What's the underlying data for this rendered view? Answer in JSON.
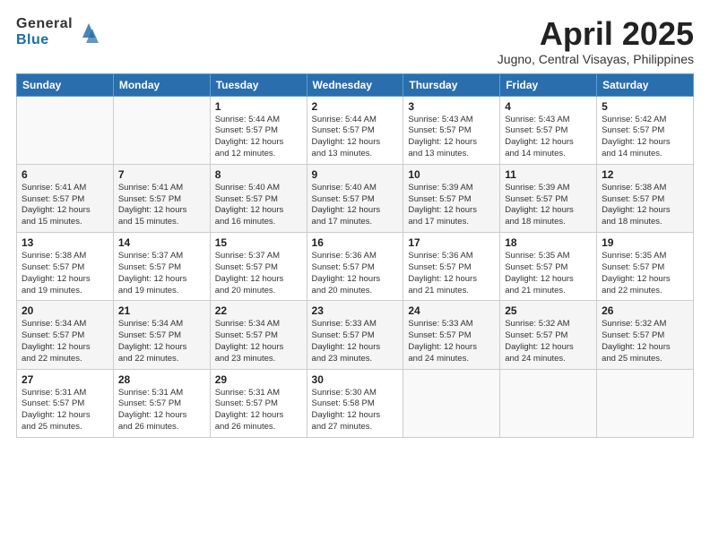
{
  "header": {
    "logo_general": "General",
    "logo_blue": "Blue",
    "month_title": "April 2025",
    "location": "Jugno, Central Visayas, Philippines"
  },
  "weekdays": [
    "Sunday",
    "Monday",
    "Tuesday",
    "Wednesday",
    "Thursday",
    "Friday",
    "Saturday"
  ],
  "weeks": [
    [
      {
        "day": "",
        "info": ""
      },
      {
        "day": "",
        "info": ""
      },
      {
        "day": "1",
        "info": "Sunrise: 5:44 AM\nSunset: 5:57 PM\nDaylight: 12 hours\nand 12 minutes."
      },
      {
        "day": "2",
        "info": "Sunrise: 5:44 AM\nSunset: 5:57 PM\nDaylight: 12 hours\nand 13 minutes."
      },
      {
        "day": "3",
        "info": "Sunrise: 5:43 AM\nSunset: 5:57 PM\nDaylight: 12 hours\nand 13 minutes."
      },
      {
        "day": "4",
        "info": "Sunrise: 5:43 AM\nSunset: 5:57 PM\nDaylight: 12 hours\nand 14 minutes."
      },
      {
        "day": "5",
        "info": "Sunrise: 5:42 AM\nSunset: 5:57 PM\nDaylight: 12 hours\nand 14 minutes."
      }
    ],
    [
      {
        "day": "6",
        "info": "Sunrise: 5:41 AM\nSunset: 5:57 PM\nDaylight: 12 hours\nand 15 minutes."
      },
      {
        "day": "7",
        "info": "Sunrise: 5:41 AM\nSunset: 5:57 PM\nDaylight: 12 hours\nand 15 minutes."
      },
      {
        "day": "8",
        "info": "Sunrise: 5:40 AM\nSunset: 5:57 PM\nDaylight: 12 hours\nand 16 minutes."
      },
      {
        "day": "9",
        "info": "Sunrise: 5:40 AM\nSunset: 5:57 PM\nDaylight: 12 hours\nand 17 minutes."
      },
      {
        "day": "10",
        "info": "Sunrise: 5:39 AM\nSunset: 5:57 PM\nDaylight: 12 hours\nand 17 minutes."
      },
      {
        "day": "11",
        "info": "Sunrise: 5:39 AM\nSunset: 5:57 PM\nDaylight: 12 hours\nand 18 minutes."
      },
      {
        "day": "12",
        "info": "Sunrise: 5:38 AM\nSunset: 5:57 PM\nDaylight: 12 hours\nand 18 minutes."
      }
    ],
    [
      {
        "day": "13",
        "info": "Sunrise: 5:38 AM\nSunset: 5:57 PM\nDaylight: 12 hours\nand 19 minutes."
      },
      {
        "day": "14",
        "info": "Sunrise: 5:37 AM\nSunset: 5:57 PM\nDaylight: 12 hours\nand 19 minutes."
      },
      {
        "day": "15",
        "info": "Sunrise: 5:37 AM\nSunset: 5:57 PM\nDaylight: 12 hours\nand 20 minutes."
      },
      {
        "day": "16",
        "info": "Sunrise: 5:36 AM\nSunset: 5:57 PM\nDaylight: 12 hours\nand 20 minutes."
      },
      {
        "day": "17",
        "info": "Sunrise: 5:36 AM\nSunset: 5:57 PM\nDaylight: 12 hours\nand 21 minutes."
      },
      {
        "day": "18",
        "info": "Sunrise: 5:35 AM\nSunset: 5:57 PM\nDaylight: 12 hours\nand 21 minutes."
      },
      {
        "day": "19",
        "info": "Sunrise: 5:35 AM\nSunset: 5:57 PM\nDaylight: 12 hours\nand 22 minutes."
      }
    ],
    [
      {
        "day": "20",
        "info": "Sunrise: 5:34 AM\nSunset: 5:57 PM\nDaylight: 12 hours\nand 22 minutes."
      },
      {
        "day": "21",
        "info": "Sunrise: 5:34 AM\nSunset: 5:57 PM\nDaylight: 12 hours\nand 22 minutes."
      },
      {
        "day": "22",
        "info": "Sunrise: 5:34 AM\nSunset: 5:57 PM\nDaylight: 12 hours\nand 23 minutes."
      },
      {
        "day": "23",
        "info": "Sunrise: 5:33 AM\nSunset: 5:57 PM\nDaylight: 12 hours\nand 23 minutes."
      },
      {
        "day": "24",
        "info": "Sunrise: 5:33 AM\nSunset: 5:57 PM\nDaylight: 12 hours\nand 24 minutes."
      },
      {
        "day": "25",
        "info": "Sunrise: 5:32 AM\nSunset: 5:57 PM\nDaylight: 12 hours\nand 24 minutes."
      },
      {
        "day": "26",
        "info": "Sunrise: 5:32 AM\nSunset: 5:57 PM\nDaylight: 12 hours\nand 25 minutes."
      }
    ],
    [
      {
        "day": "27",
        "info": "Sunrise: 5:31 AM\nSunset: 5:57 PM\nDaylight: 12 hours\nand 25 minutes."
      },
      {
        "day": "28",
        "info": "Sunrise: 5:31 AM\nSunset: 5:57 PM\nDaylight: 12 hours\nand 26 minutes."
      },
      {
        "day": "29",
        "info": "Sunrise: 5:31 AM\nSunset: 5:57 PM\nDaylight: 12 hours\nand 26 minutes."
      },
      {
        "day": "30",
        "info": "Sunrise: 5:30 AM\nSunset: 5:58 PM\nDaylight: 12 hours\nand 27 minutes."
      },
      {
        "day": "",
        "info": ""
      },
      {
        "day": "",
        "info": ""
      },
      {
        "day": "",
        "info": ""
      }
    ]
  ]
}
